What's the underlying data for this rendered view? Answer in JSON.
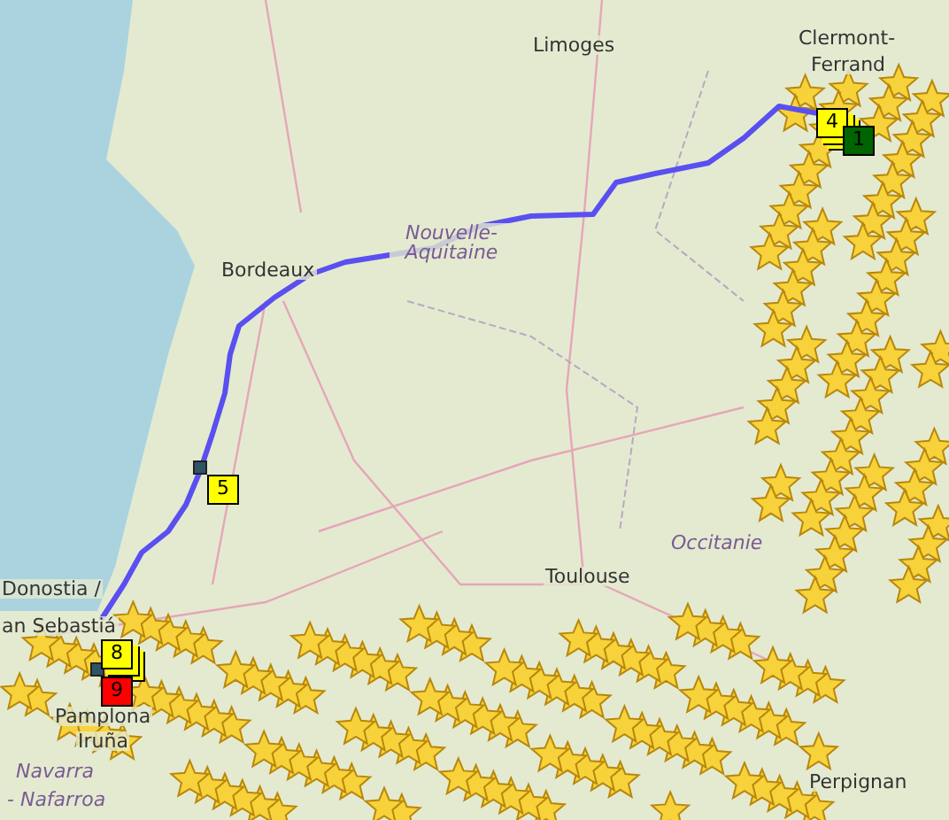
{
  "map": {
    "labels": [
      {
        "text": "Limoges",
        "kind": "city"
      },
      {
        "text": "Clermont-",
        "kind": "city"
      },
      {
        "text": "Ferrand",
        "kind": "city"
      },
      {
        "text": "Nouvelle-Aquitaine",
        "kind": "region"
      },
      {
        "text": "Bordeaux",
        "kind": "city"
      },
      {
        "text": "Toulouse",
        "kind": "city"
      },
      {
        "text": "Occitanie",
        "kind": "region"
      },
      {
        "text": "Donostia /",
        "kind": "city"
      },
      {
        "text": "an Sebastiá",
        "kind": "city"
      },
      {
        "text": "Pamplona",
        "kind": "city"
      },
      {
        "text": "Iruña",
        "kind": "city"
      },
      {
        "text": "Navarra",
        "kind": "region"
      },
      {
        "text": "- Nafarroa",
        "kind": "region"
      },
      {
        "text": "Perpignan",
        "kind": "city"
      }
    ],
    "markers": [
      {
        "number": "4",
        "color": "#ffff00",
        "stacked": true
      },
      {
        "number": "1",
        "color": "#006400",
        "stacked": false
      },
      {
        "number": "5",
        "color": "#ffff00",
        "stacked": false
      },
      {
        "number": "8",
        "color": "#ffff00",
        "stacked": true
      },
      {
        "number": "9",
        "color": "#ff0000",
        "stacked": false
      }
    ]
  }
}
